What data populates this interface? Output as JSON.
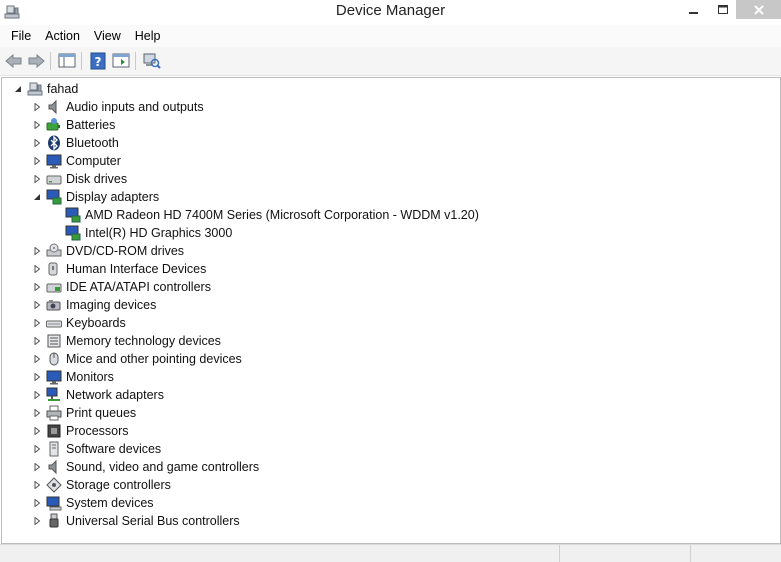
{
  "window": {
    "title": "Device Manager"
  },
  "menu": [
    "File",
    "Action",
    "View",
    "Help"
  ],
  "tree": {
    "root": "fahad",
    "categories": [
      {
        "label": "Audio inputs and outputs",
        "icon": "speaker-icon"
      },
      {
        "label": "Batteries",
        "icon": "battery-icon"
      },
      {
        "label": "Bluetooth",
        "icon": "bluetooth-icon"
      },
      {
        "label": "Computer",
        "icon": "computer-icon"
      },
      {
        "label": "Disk drives",
        "icon": "disk-drive-icon"
      },
      {
        "label": "Display adapters",
        "icon": "display-adapter-icon"
      },
      {
        "label": "AMD Radeon HD 7400M Series (Microsoft Corporation - WDDM v1.20)",
        "icon": "display-adapter-icon"
      },
      {
        "label": "Intel(R) HD Graphics 3000",
        "icon": "display-adapter-icon"
      },
      {
        "label": "DVD/CD-ROM drives",
        "icon": "optical-drive-icon"
      },
      {
        "label": "Human Interface Devices",
        "icon": "hid-icon"
      },
      {
        "label": "IDE ATA/ATAPI controllers",
        "icon": "ide-controller-icon"
      },
      {
        "label": "Imaging devices",
        "icon": "camera-icon"
      },
      {
        "label": "Keyboards",
        "icon": "keyboard-icon"
      },
      {
        "label": "Memory technology devices",
        "icon": "memory-icon"
      },
      {
        "label": "Mice and other pointing devices",
        "icon": "mouse-icon"
      },
      {
        "label": "Monitors",
        "icon": "monitor-icon"
      },
      {
        "label": "Network adapters",
        "icon": "network-adapter-icon"
      },
      {
        "label": "Print queues",
        "icon": "printer-icon"
      },
      {
        "label": "Processors",
        "icon": "processor-icon"
      },
      {
        "label": "Software devices",
        "icon": "software-device-icon"
      },
      {
        "label": "Sound, video and game controllers",
        "icon": "speaker-icon"
      },
      {
        "label": "Storage controllers",
        "icon": "storage-controller-icon"
      },
      {
        "label": "System devices",
        "icon": "system-device-icon"
      },
      {
        "label": "Universal Serial Bus controllers",
        "icon": "usb-icon"
      }
    ]
  }
}
